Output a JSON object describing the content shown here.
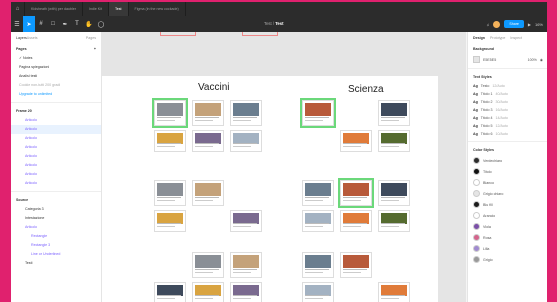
{
  "tabs": [
    {
      "label": "Kidsheath (with) per daubler"
    },
    {
      "label": "Indie Kit"
    },
    {
      "label": "Test"
    },
    {
      "label": "Figma (in the new cockade)"
    }
  ],
  "header": {
    "project": "Test",
    "file": "Test",
    "zoom": "16%",
    "share_label": "Share"
  },
  "left_panel": {
    "tabs": [
      "Layers",
      "Assets",
      "Pages"
    ],
    "pages_title": "Pages",
    "pages": [
      "Notes",
      "Pagina spiegazioni",
      "Analisi testi",
      "Cookie non-tutti 200 gradi",
      "Upgrade to unlimited"
    ],
    "frames_title": "Frame 20",
    "frames": [
      "Articolo",
      "Articolo",
      "Articolo",
      "Articolo",
      "Articolo",
      "Articolo",
      "Articolo",
      "Articolo"
    ],
    "sources_title": "Source",
    "sources": [
      "Categoria 3",
      "Intestazione",
      "Articolo",
      "Rectangle",
      "Rectangle 3",
      "Line or Underlined",
      "Testi"
    ]
  },
  "canvas": {
    "left_title": "Vaccini",
    "right_title": "Scienza"
  },
  "right_panel": {
    "tabs": [
      "Design",
      "Prototype",
      "Inspect"
    ],
    "background_title": "Background",
    "background_hex": "E5E5E5",
    "background_opacity": "100%",
    "text_styles_title": "Text Styles",
    "text_styles": [
      {
        "name": "Testo",
        "detail": "12/Auto"
      },
      {
        "name": "Titolo 1",
        "detail": "40/Auto"
      },
      {
        "name": "Titolo 2",
        "detail": "30/Auto"
      },
      {
        "name": "Titolo 3",
        "detail": "16/Auto"
      },
      {
        "name": "Titolo 4",
        "detail": "14/Auto"
      },
      {
        "name": "Titolo 5",
        "detail": "12/Auto"
      },
      {
        "name": "Titolo 6",
        "detail": "10/Auto"
      }
    ],
    "color_styles_title": "Color Styles",
    "color_styles": [
      {
        "name": "Verdechiaro",
        "color": "#2c2c2c"
      },
      {
        "name": "Titolo",
        "color": "#111111"
      },
      {
        "name": "Bianco",
        "color": "#ffffff"
      },
      {
        "name": "Grigio chiaro",
        "color": "#e5e5e5"
      },
      {
        "name": "Blu fill",
        "color": "#1b1b1b"
      },
      {
        "name": "Arancio",
        "color": "#ffffff"
      },
      {
        "name": "Viola",
        "color": "#7b4fa8"
      },
      {
        "name": "Rosa",
        "color": "#d4648c"
      },
      {
        "name": "Lilla",
        "color": "#a08ad0"
      },
      {
        "name": "Grigio",
        "color": "#999999"
      }
    ]
  }
}
